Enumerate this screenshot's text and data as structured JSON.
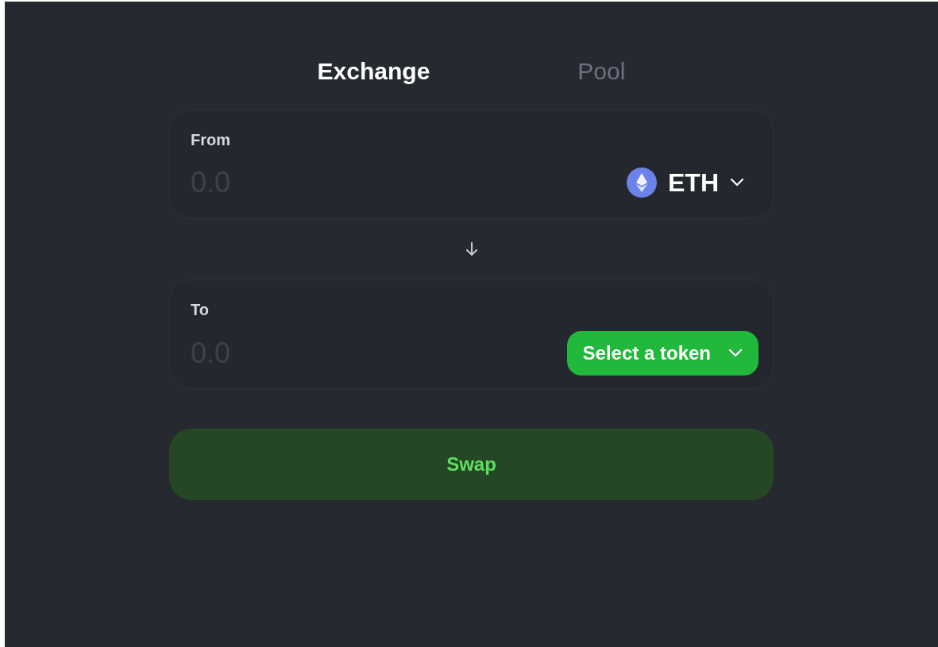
{
  "tabs": [
    {
      "label": "Exchange",
      "selected": true
    },
    {
      "label": "Pool",
      "selected": false
    }
  ],
  "panels": [
    {
      "label": "From",
      "placeholder": "0.0",
      "token": {
        "kind": "token",
        "symbol": "ETH"
      }
    },
    {
      "label": "To",
      "placeholder": "0.0",
      "token": {
        "kind": "select",
        "label": "Select a token"
      }
    }
  ],
  "swap_button": {
    "label": "Swap"
  }
}
